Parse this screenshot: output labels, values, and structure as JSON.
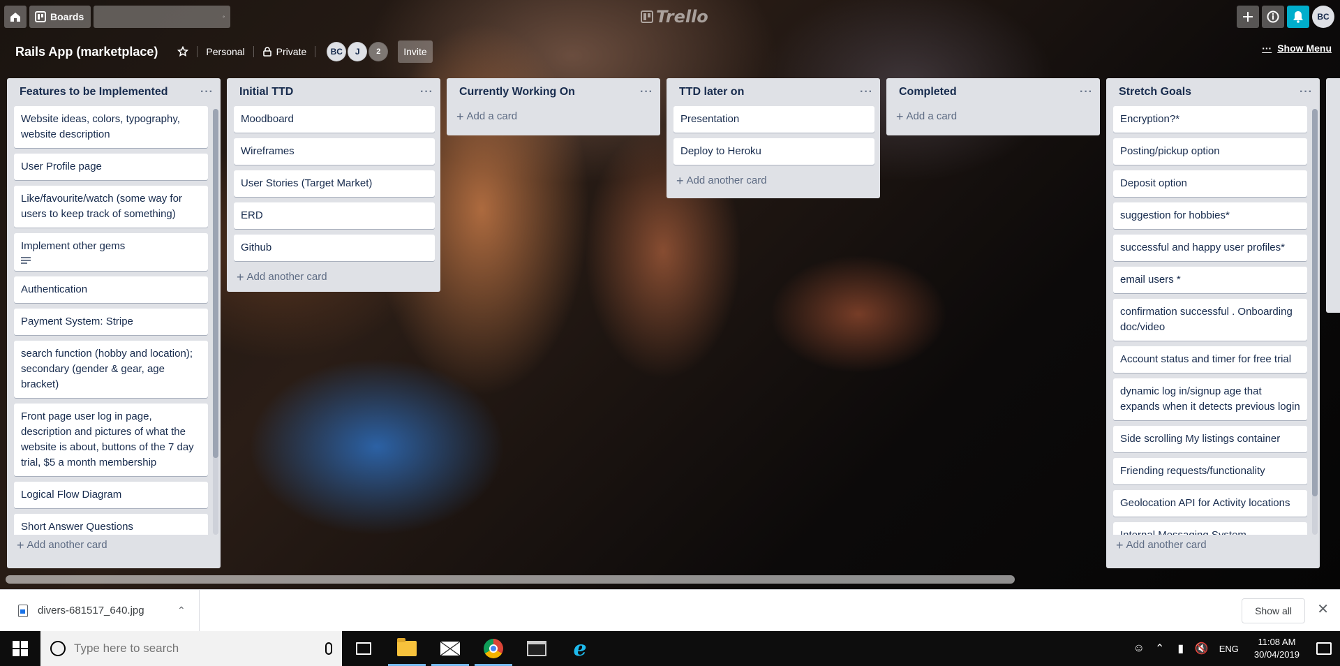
{
  "header": {
    "boards_label": "Boards",
    "logo_text": "Trello",
    "user_initials": "BC",
    "icons": [
      "home-icon",
      "boards-icon",
      "search-icon",
      "plus-icon",
      "info-icon",
      "bell-icon"
    ],
    "accent_color": "#00aecc"
  },
  "board": {
    "title": "Rails App (marketplace)",
    "team": "Personal",
    "visibility": "Private",
    "members": [
      "BC",
      "J"
    ],
    "member_count_extra": "2",
    "invite_label": "Invite",
    "show_menu_label": "Show Menu"
  },
  "lists": [
    {
      "title": "Features to be Implemented",
      "cards": [
        "Website ideas, colors, typography, website description",
        "User Profile page",
        "Like/favourite/watch (some way for users to keep track of something)",
        "Implement other gems",
        "Authentication",
        "Payment System: Stripe",
        "search function (hobby and location); secondary (gender & gear, age bracket)",
        "Front page user log in page, description and pictures of what the website is about, buttons of the 7 day trial, $5 a month membership",
        "Logical Flow Diagram",
        "Short Answer Questions"
      ],
      "add_label": "Add another card"
    },
    {
      "title": "Initial TTD",
      "cards": [
        "Moodboard",
        "Wireframes",
        "User Stories (Target Market)",
        "ERD",
        "Github"
      ],
      "add_label": "Add another card"
    },
    {
      "title": "Currently Working On",
      "cards": [],
      "add_label": "Add a card"
    },
    {
      "title": "TTD later on",
      "cards": [
        "Presentation",
        "Deploy to Heroku"
      ],
      "add_label": "Add another card"
    },
    {
      "title": "Completed",
      "cards": [],
      "add_label": "Add a card"
    },
    {
      "title": "Stretch Goals",
      "cards": [
        "Encryption?*",
        "Posting/pickup option",
        "Deposit option",
        "suggestion for hobbies*",
        "successful and happy user profiles*",
        "email users *",
        "confirmation successful . Onboarding doc/video",
        "Account status and timer for free trial",
        "dynamic log in/signup age that expands when it detects previous login",
        "Side scrolling My listings container",
        "Friending requests/functionality",
        "Geolocation API for Activity locations",
        "Internal Messaging System"
      ],
      "add_label": "Add another card"
    }
  ],
  "download_bar": {
    "file_name": "divers-681517_640.jpg",
    "show_all_label": "Show all"
  },
  "taskbar": {
    "search_placeholder": "Type here to search",
    "language": "ENG",
    "time": "11:08 AM",
    "date": "30/04/2019"
  }
}
